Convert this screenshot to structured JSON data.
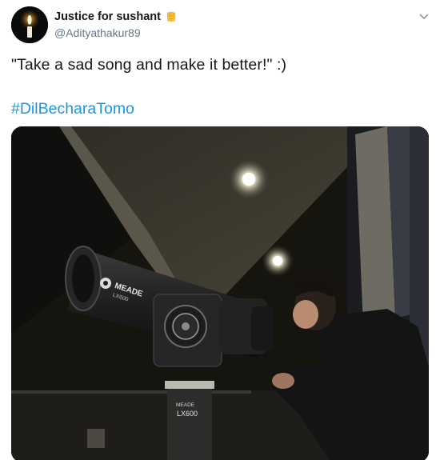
{
  "author": {
    "display_name": "Justice for sushant",
    "badge_icon": "raised-fist-emoji-icon",
    "handle": "@Adityathakur89"
  },
  "tweet": {
    "text": "\"Take a sad song and make it better!\" :)",
    "hashtag": "#DilBecharaTomo"
  },
  "media": {
    "telescope_brand": "MEADE",
    "telescope_model": "LX600",
    "mount_brand": "MEADE",
    "mount_model": "LX600"
  },
  "colors": {
    "link": "#1b95e0",
    "handle": "#657786",
    "text": "#14171a"
  },
  "icons": {
    "menu": "chevron-down-icon"
  }
}
